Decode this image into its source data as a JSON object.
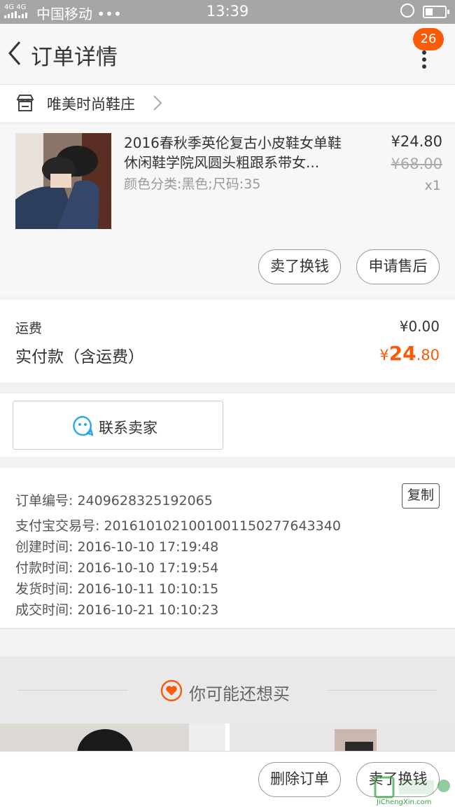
{
  "status_bar": {
    "network": "4G 4G",
    "carrier": "中国移动 •••",
    "time": "13:39"
  },
  "nav": {
    "title": "订单详情",
    "badge_count": "26"
  },
  "shop": {
    "name": "唯美时尚鞋庄"
  },
  "product": {
    "title": "2016春秋季英伦复古小皮鞋女单鞋休闲鞋学院风圆头粗跟系带女...",
    "sku": "颜色分类:黑色;尺码:35",
    "price": "¥24.80",
    "original_price": "¥68.00",
    "quantity": "x1",
    "sell_button": "卖了换钱",
    "aftersale_button": "申请售后"
  },
  "fees": {
    "shipping_label": "运费",
    "shipping_value": "¥0.00",
    "paid_label": "实付款（含运费）",
    "paid_currency": "¥",
    "paid_integer": "24",
    "paid_decimal": ".80"
  },
  "contact": {
    "label": "联系卖家"
  },
  "order_info": {
    "copy_button": "复制",
    "rows": [
      "订单编号: 2409628325192065",
      "支付宝交易号: 2016101021001001150277643340",
      "创建时间: 2016-10-10 17:19:48",
      "付款时间: 2016-10-10 17:19:54",
      "发货时间: 2016-10-11 10:10:15",
      "成交时间: 2016-10-21 10:10:23"
    ]
  },
  "recommend": {
    "title": "你可能还想买"
  },
  "bottom_bar": {
    "delete_button": "删除订单",
    "sell_button": "卖了换钱"
  },
  "watermark": {
    "text": "JiChengXin.com"
  },
  "colors": {
    "accent": "#f85b0a",
    "status_bar": "#a6a6a6",
    "contact_icon": "#2fa7e6"
  }
}
